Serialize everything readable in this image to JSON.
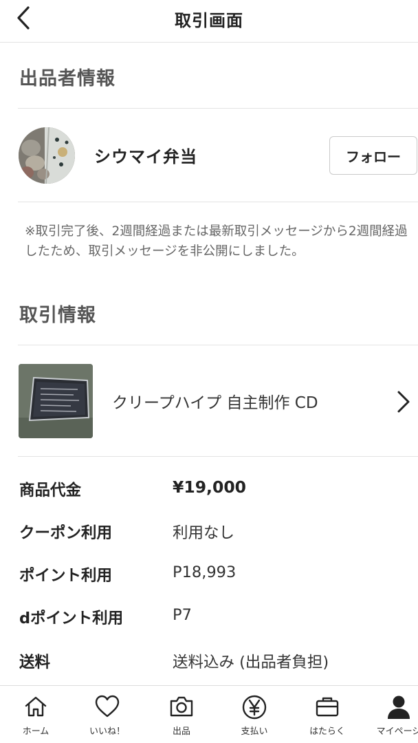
{
  "header": {
    "title": "取引画面",
    "back_icon": "chevron-left-icon"
  },
  "seller_section": {
    "title": "出品者情報",
    "seller_name": "シウマイ弁当",
    "follow_label": "フォロー",
    "notice": "※取引完了後、2週間経過または最新取引メッセージから2週間経過したため、取引メッセージを非公開にしました。"
  },
  "transaction_section": {
    "title": "取引情報",
    "product_name": "クリープハイプ 自主制作 CD",
    "rows": [
      {
        "label": "商品代金",
        "value": "¥19,000"
      },
      {
        "label": "クーポン利用",
        "value": "利用なし"
      },
      {
        "label": "ポイント利用",
        "value": "P18,993"
      },
      {
        "label": "dポイント利用",
        "value": "P7"
      },
      {
        "label": "送料",
        "value": "送料込み (出品者負担)"
      }
    ]
  },
  "tabbar": {
    "tabs": [
      {
        "label": "ホーム",
        "icon": "home-icon"
      },
      {
        "label": "いいね！",
        "icon": "heart-icon"
      },
      {
        "label": "出品",
        "icon": "camera-icon"
      },
      {
        "label": "支払い",
        "icon": "yen-icon"
      },
      {
        "label": "はたらく",
        "icon": "briefcase-icon"
      },
      {
        "label": "マイページ",
        "icon": "user-icon"
      }
    ]
  },
  "colors": {
    "divider": "#e3e3e3",
    "section_title": "#555555",
    "text": "#222222",
    "notice": "#666666"
  }
}
